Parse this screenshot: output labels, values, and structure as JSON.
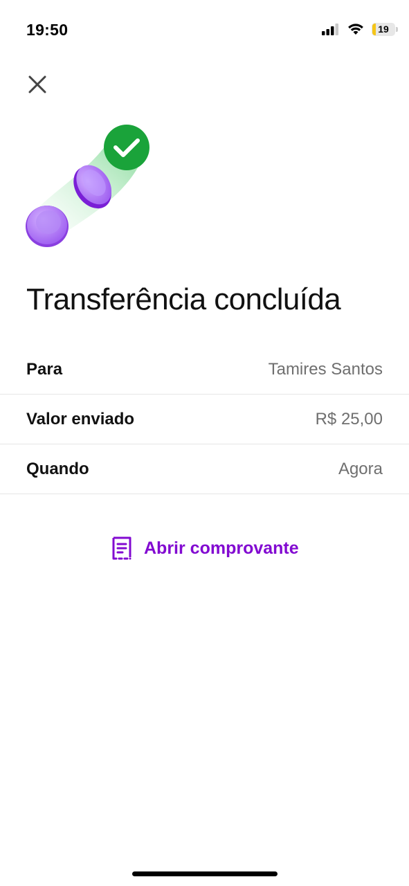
{
  "status_bar": {
    "time": "19:50",
    "battery_level": "19",
    "icons": [
      "signal-icon",
      "wifi-icon",
      "battery-icon"
    ]
  },
  "header": {
    "close_icon": "close-icon"
  },
  "illustration": {
    "icons": [
      "coin-icon",
      "coin-icon",
      "check-circle-icon"
    ],
    "colors": {
      "coin": "#a56bf0",
      "check": "#15a34a",
      "trail": "#b9ecc5"
    }
  },
  "main": {
    "title": "Transferência concluída",
    "details": [
      {
        "label": "Para",
        "value": "Tamires Santos"
      },
      {
        "label": "Valor enviado",
        "value": "R$ 25,00"
      },
      {
        "label": "Quando",
        "value": "Agora"
      }
    ],
    "receipt_button": {
      "label": "Abrir comprovante",
      "icon": "receipt-icon"
    }
  },
  "colors": {
    "accent": "#820ad1",
    "text_primary": "#111111",
    "text_secondary": "#6f6f6f",
    "divider": "#e6e6e6"
  }
}
